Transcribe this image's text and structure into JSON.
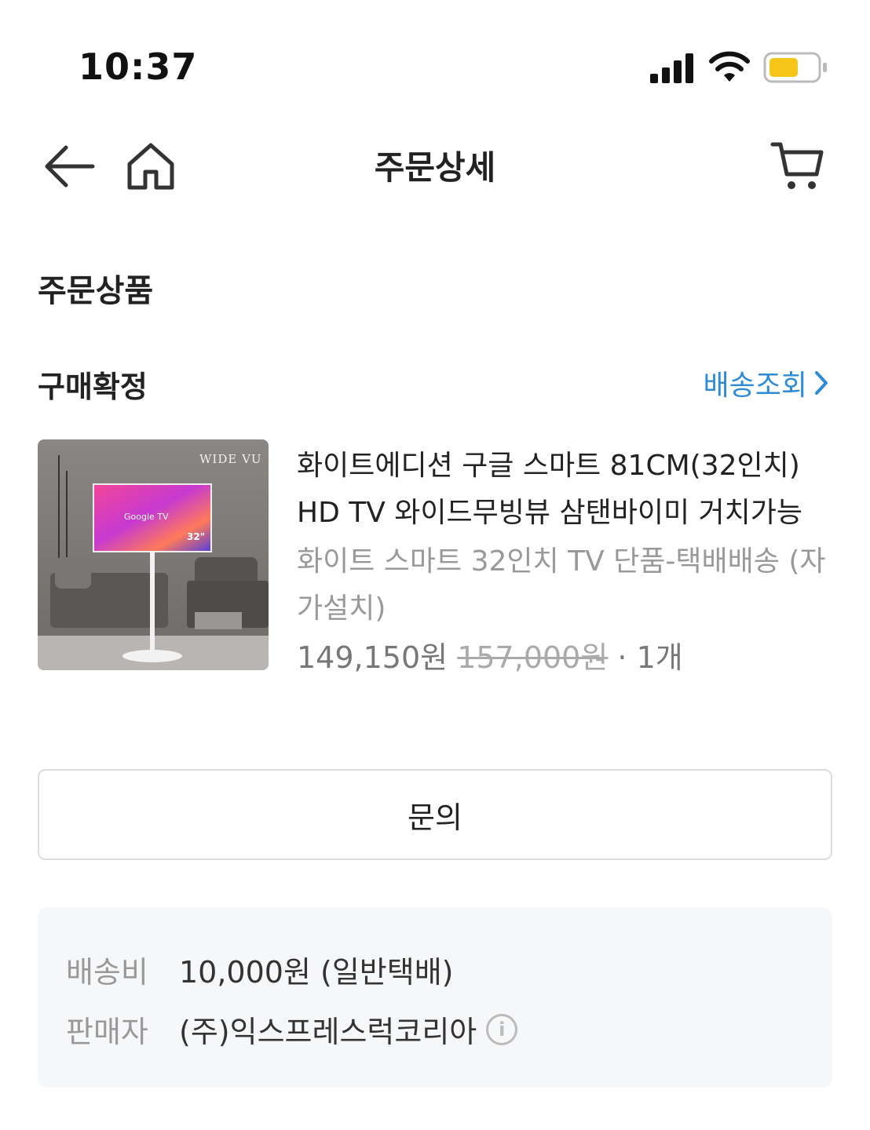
{
  "status_bar": {
    "time": "10:37"
  },
  "nav": {
    "title": "주문상세"
  },
  "section": {
    "title": "주문상품"
  },
  "order": {
    "status": "구매확정",
    "track_link": "배송조회"
  },
  "product": {
    "image_brand": "WIDE VU",
    "image_badge_google": "Google TV",
    "image_badge_size": "32\"",
    "name": "화이트에디션 구글 스마트 81CM(32인치) HD TV 와이드무빙뷰 삼탠바이미 거치가능",
    "option": "화이트 스마트 32인치 TV 단품-택배배송 (자가설치)",
    "price": "149,150원",
    "original_price": "157,000원",
    "quantity": "· 1개"
  },
  "inquiry_button": "문의",
  "info": {
    "shipping_label": "배송비",
    "shipping_value": "10,000원 (일반택배)",
    "seller_label": "판매자",
    "seller_value": "(주)익스프레스럭코리아"
  },
  "colors": {
    "link": "#2e8bd6",
    "battery": "#f5c518"
  }
}
